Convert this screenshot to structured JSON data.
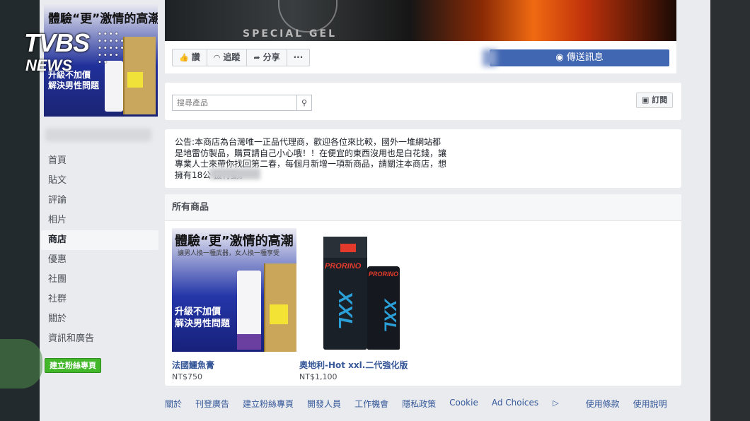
{
  "watermark": {
    "line1": "TVBS",
    "line2": "NEWS"
  },
  "profile_image": {
    "headline": "體驗“更”激情的高潮",
    "slogan_lines": [
      "升級不加價",
      "解決男性問題"
    ]
  },
  "sidebar": {
    "items": [
      {
        "label": "首頁"
      },
      {
        "label": "貼文"
      },
      {
        "label": "評論"
      },
      {
        "label": "相片"
      },
      {
        "label": "商店",
        "active": true
      },
      {
        "label": "優惠"
      },
      {
        "label": "社團"
      },
      {
        "label": "社群"
      },
      {
        "label": "關於"
      },
      {
        "label": "資訊和廣告"
      }
    ],
    "create_page_button": "建立粉絲專頁"
  },
  "cover": {
    "text": "SPECIAL GEL"
  },
  "actions": {
    "like": "讚",
    "follow": "追蹤",
    "share": "分享",
    "more": "···",
    "send_message": "傳送訊息"
  },
  "shop": {
    "search_placeholder": "搜尋產品",
    "subscribe": "訂閱"
  },
  "announcement": {
    "lines": [
      "公告:本商店為台灣唯一正品代理商，歡迎各位來比較，國外一堆網站都",
      "是地雷仿製品，購買請自己小心哦！！在便宜的東西沒用也是白花錢，讓",
      "專業人士來帶你找回第二春，每個月新增一項新商品，請關注本商店，想",
      "擁有18公         援行動。"
    ]
  },
  "products": {
    "header": "所有商品",
    "items": [
      {
        "name": "法國鱷魚膏",
        "price": "NT$750",
        "image_headline": "體驗“更”激情的高潮",
        "image_subline": "讓男人換一種武器，女人換一種享受",
        "image_slogan": [
          "升級不加價",
          "解決男性問題"
        ]
      },
      {
        "name": "奧地利-Hot xxl.二代強化版",
        "price": "NT$1,100",
        "image_brand": "PRORINO",
        "image_mark": "XXL"
      }
    ]
  },
  "footer": {
    "links": [
      "關於",
      "刊登廣告",
      "建立粉絲專頁",
      "開發人員",
      "工作機會",
      "隱私政策",
      "Cookie",
      "Ad Choices",
      "使用條款",
      "使用說明"
    ]
  },
  "colors": {
    "page_bg": "#e9ebee",
    "link": "#365899",
    "messenger_blue": "#4267b2",
    "green_button": "#42b72a"
  }
}
